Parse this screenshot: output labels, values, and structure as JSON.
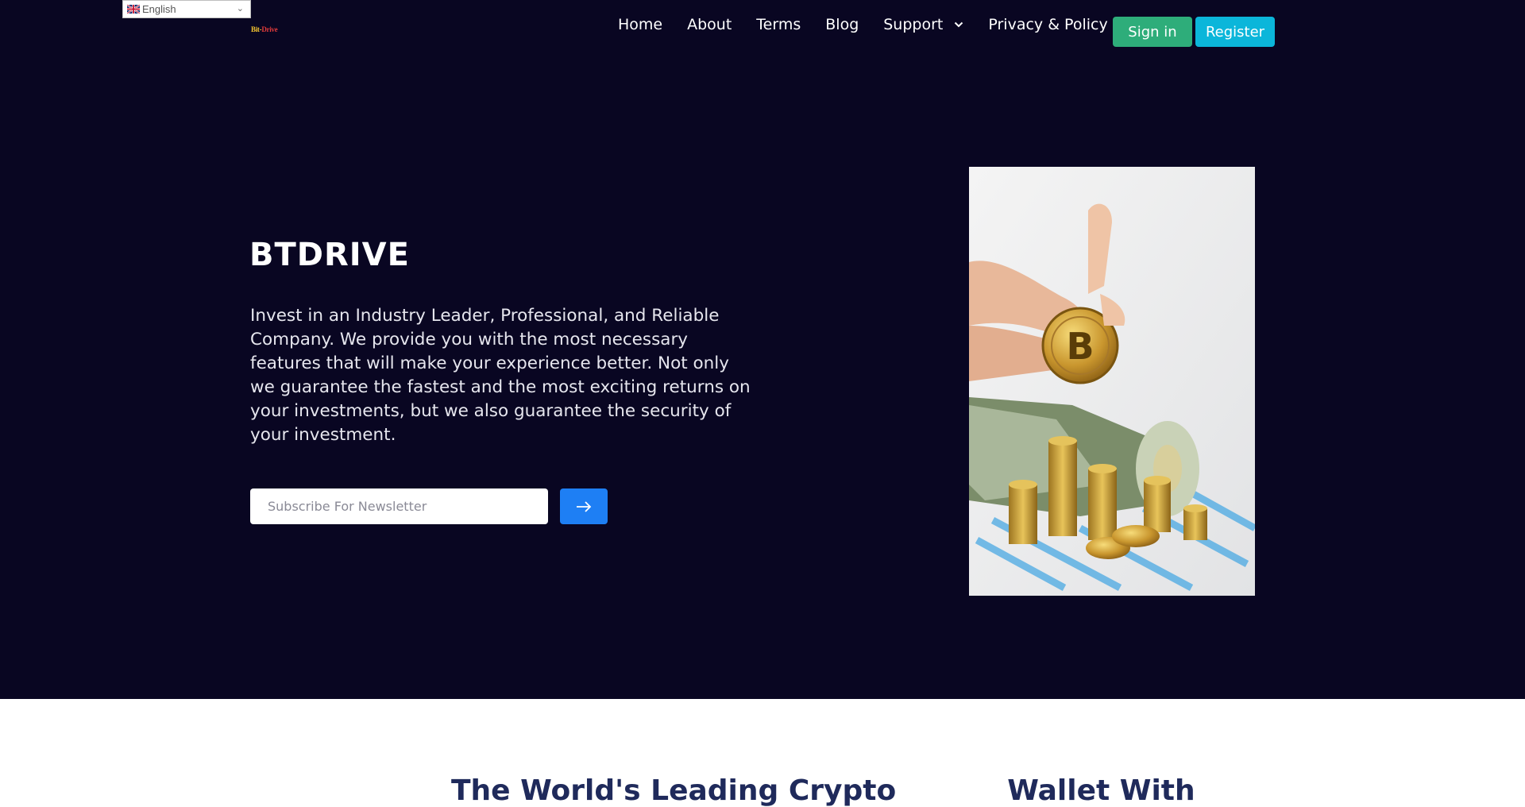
{
  "language": {
    "label": "English"
  },
  "logo": {
    "part1": "Bit-",
    "part2": "Drive"
  },
  "nav": [
    {
      "label": "Home",
      "caret": false
    },
    {
      "label": "About",
      "caret": false
    },
    {
      "label": "Terms",
      "caret": false
    },
    {
      "label": "Blog",
      "caret": false
    },
    {
      "label": "Support",
      "caret": true
    },
    {
      "label": "Privacy & Policy",
      "caret": true
    }
  ],
  "auth": {
    "signin": "Sign in",
    "register": "Register"
  },
  "hero": {
    "title": "BTDRIVE",
    "description": "Invest in an Industry Leader, Professional, and Reliable Company. We provide you with the most necessary features that will make your experience better. Not only we guarantee the fastest and the most exciting returns on your investments, but we also guarantee the security of your investment.",
    "newsletter_placeholder": "Subscribe For Newsletter"
  },
  "section2": {
    "heading_left": "The World's Leading Crypto",
    "heading_right": "Wallet With"
  },
  "colors": {
    "hero_bg": "#090622",
    "signin": "#2ead7a",
    "register": "#0bb6da",
    "submit": "#1e7ff4",
    "heading2": "#1f2a5b"
  }
}
